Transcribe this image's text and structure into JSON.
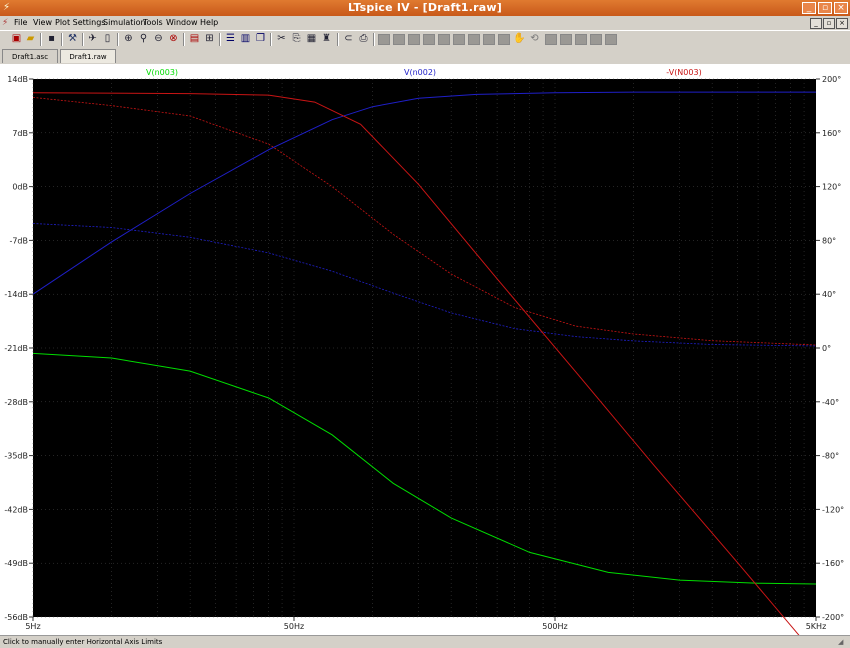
{
  "window": {
    "title": "LTspice IV - [Draft1.raw]",
    "controls": [
      "_",
      "▫",
      "×"
    ]
  },
  "menu": {
    "items": [
      "File",
      "View",
      "Plot Settings",
      "Simulation",
      "Tools",
      "Window",
      "Help"
    ],
    "mdi_controls": [
      "_",
      "▫",
      "×"
    ]
  },
  "toolbar": {
    "icons": [
      "new-schematic-icon",
      "open-icon",
      "save-icon",
      "control-panel-icon",
      "run-icon",
      "halt-icon",
      "zoom-in-icon",
      "pan-icon",
      "zoom-out-icon",
      "zoom-fit-icon",
      "autorange-icon",
      "grid-icon",
      "tile-horizontal-icon",
      "tile-vertical-icon",
      "cascade-icon",
      "cut-icon",
      "copy-icon",
      "paste-icon",
      "find-icon",
      "print-preview-icon",
      "print-icon"
    ]
  },
  "tabs": [
    {
      "label": "Draft1.asc",
      "active": false
    },
    {
      "label": "Draft1.raw",
      "active": true
    }
  ],
  "status": {
    "text": "Click to manually enter Horizontal Axis Limits"
  },
  "colors": {
    "green": "#00dd00",
    "blue": "#1f1fc8",
    "red": "#c81414",
    "background": "#000000",
    "grid": "#ffffff"
  },
  "chart_data": {
    "type": "line",
    "title": "",
    "x_scale": "log",
    "x_ticks": [
      "5Hz",
      "50Hz",
      "500Hz",
      "5KHz"
    ],
    "x_range_hz": [
      5,
      5000
    ],
    "left_axis": {
      "unit": "dB",
      "range": [
        -56,
        14
      ],
      "ticks": [
        "14dB",
        "7dB",
        "0dB",
        "-7dB",
        "-14dB",
        "-21dB",
        "-28dB",
        "-35dB",
        "-42dB",
        "-49dB",
        "-56dB"
      ]
    },
    "right_axis": {
      "unit": "°",
      "range": [
        -200,
        200
      ],
      "ticks": [
        "200°",
        "160°",
        "120°",
        "80°",
        "40°",
        "0°",
        "-40°",
        "-80°",
        "-120°",
        "-160°",
        "-200°"
      ]
    },
    "series": [
      {
        "name": "V(n003)",
        "color": "#00dd00",
        "magnitude_db": [
          [
            5,
            -21.7
          ],
          [
            10,
            -22.3
          ],
          [
            20,
            -24.0
          ],
          [
            40,
            -27.5
          ],
          [
            70,
            -32.3
          ],
          [
            120,
            -38.6
          ],
          [
            200,
            -43.1
          ],
          [
            400,
            -47.6
          ],
          [
            800,
            -50.2
          ],
          [
            1500,
            -51.2
          ],
          [
            3000,
            -51.6
          ],
          [
            5000,
            -51.7
          ]
        ],
        "phase_deg": []
      },
      {
        "name": "V(n002)",
        "color": "#1f1fc8",
        "magnitude_db": [
          [
            5,
            -14.0
          ],
          [
            10,
            -7.2
          ],
          [
            20,
            -0.9
          ],
          [
            40,
            4.8
          ],
          [
            70,
            8.7
          ],
          [
            100,
            10.4
          ],
          [
            150,
            11.5
          ],
          [
            250,
            12.0
          ],
          [
            500,
            12.2
          ],
          [
            1000,
            12.3
          ],
          [
            5000,
            12.3
          ]
        ],
        "phase_deg": [
          [
            5,
            92.6
          ],
          [
            10,
            89.6
          ],
          [
            20,
            82.3
          ],
          [
            40,
            70.7
          ],
          [
            70,
            57.1
          ],
          [
            120,
            40.8
          ],
          [
            200,
            26.1
          ],
          [
            350,
            14.4
          ],
          [
            600,
            8.5
          ],
          [
            1000,
            5.3
          ],
          [
            2000,
            2.6
          ],
          [
            5000,
            1.5
          ]
        ]
      },
      {
        "name": "-V(N003)",
        "color": "#c81414",
        "magnitude_db": [
          [
            5,
            12.2
          ],
          [
            20,
            12.1
          ],
          [
            40,
            11.9
          ],
          [
            60,
            11.0
          ],
          [
            90,
            8.1
          ],
          [
            150,
            0.3
          ],
          [
            300,
            -12.0
          ],
          [
            600,
            -24.1
          ],
          [
            1200,
            -36.3
          ],
          [
            2500,
            -48.9
          ],
          [
            5000,
            -61.0
          ]
        ],
        "phase_deg": [
          [
            5,
            186.3
          ],
          [
            10,
            180.2
          ],
          [
            20,
            172.5
          ],
          [
            40,
            151.6
          ],
          [
            70,
            120.0
          ],
          [
            120,
            84.5
          ],
          [
            200,
            55.0
          ],
          [
            350,
            30.1
          ],
          [
            600,
            16.3
          ],
          [
            1000,
            10.4
          ],
          [
            2000,
            5.4
          ],
          [
            5000,
            2.2
          ]
        ]
      }
    ]
  }
}
